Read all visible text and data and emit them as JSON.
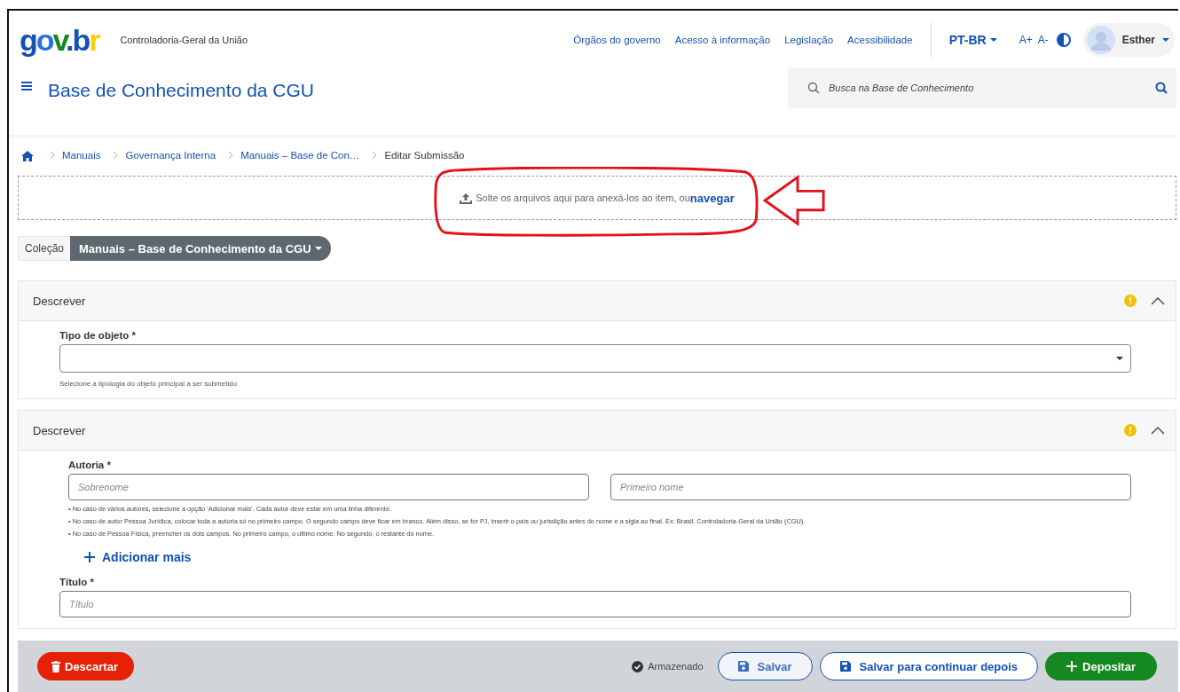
{
  "header": {
    "logo": "gov.br",
    "organization": "Controladoria-Geral da União",
    "links": [
      "Órgãos do governo",
      "Acesso à informação",
      "Legislação",
      "Acessibilidade"
    ],
    "language": "PT-BR",
    "font_increase": "A+",
    "font_decrease": "A-",
    "user": "Esther"
  },
  "site_title": "Base de Conhecimento da CGU",
  "search": {
    "placeholder": "Busca na Base de Conhecimento"
  },
  "breadcrumb": [
    {
      "label": "Manuais",
      "current": false
    },
    {
      "label": "Governança Interna",
      "current": false
    },
    {
      "label": "Manuais – Base de Con…",
      "current": false
    },
    {
      "label": "Editar Submissão",
      "current": true
    }
  ],
  "dropzone": {
    "text": "Solte os arquivos aqui para anexá-los ao item, ou",
    "link": "navegar"
  },
  "collection": {
    "label": "Coleção",
    "value": "Manuais – Base de Conhecimento da CGU"
  },
  "sections": [
    {
      "title": "Descrever",
      "expanded": true,
      "warning": true,
      "fields": [
        {
          "kind": "select",
          "label": "Tipo de objeto *",
          "hint": "Selecione a tipologia do objeto principal a ser submetido"
        }
      ]
    },
    {
      "title": "Descrever",
      "expanded": true,
      "warning": true,
      "fields": [
        {
          "kind": "name",
          "label": "Autoria *",
          "placeholders": [
            "Sobrenome",
            "Primeiro nome"
          ],
          "notes": [
            "• No caso de vários autores, selecione a opção 'Adicionar mais'. Cada autor deve estar em uma linha diferente.",
            "• No caso de autor Pessoa Jurídica, colocar toda a autoria só no primeiro campo. O segundo campo deve ficar em branco. Além disso, se for PJ, inserir o país ou jurisdição antes do nome e a sigla ao final. Ex: Brasil. Controladoria-Geral da União (CGU).",
            "• No caso de Pessoa Física, preencher os dois campos. No primeiro campo, o último nome. No segundo, o restante do nome."
          ],
          "add_more": "Adicionar mais"
        },
        {
          "kind": "text",
          "label": "Título *",
          "placeholder": "Título"
        }
      ]
    }
  ],
  "footer": {
    "discard": "Descartar",
    "status": "Armazenado",
    "save": "Salvar",
    "save_later": "Salvar para continuar depois",
    "deposit": "Depositar"
  }
}
